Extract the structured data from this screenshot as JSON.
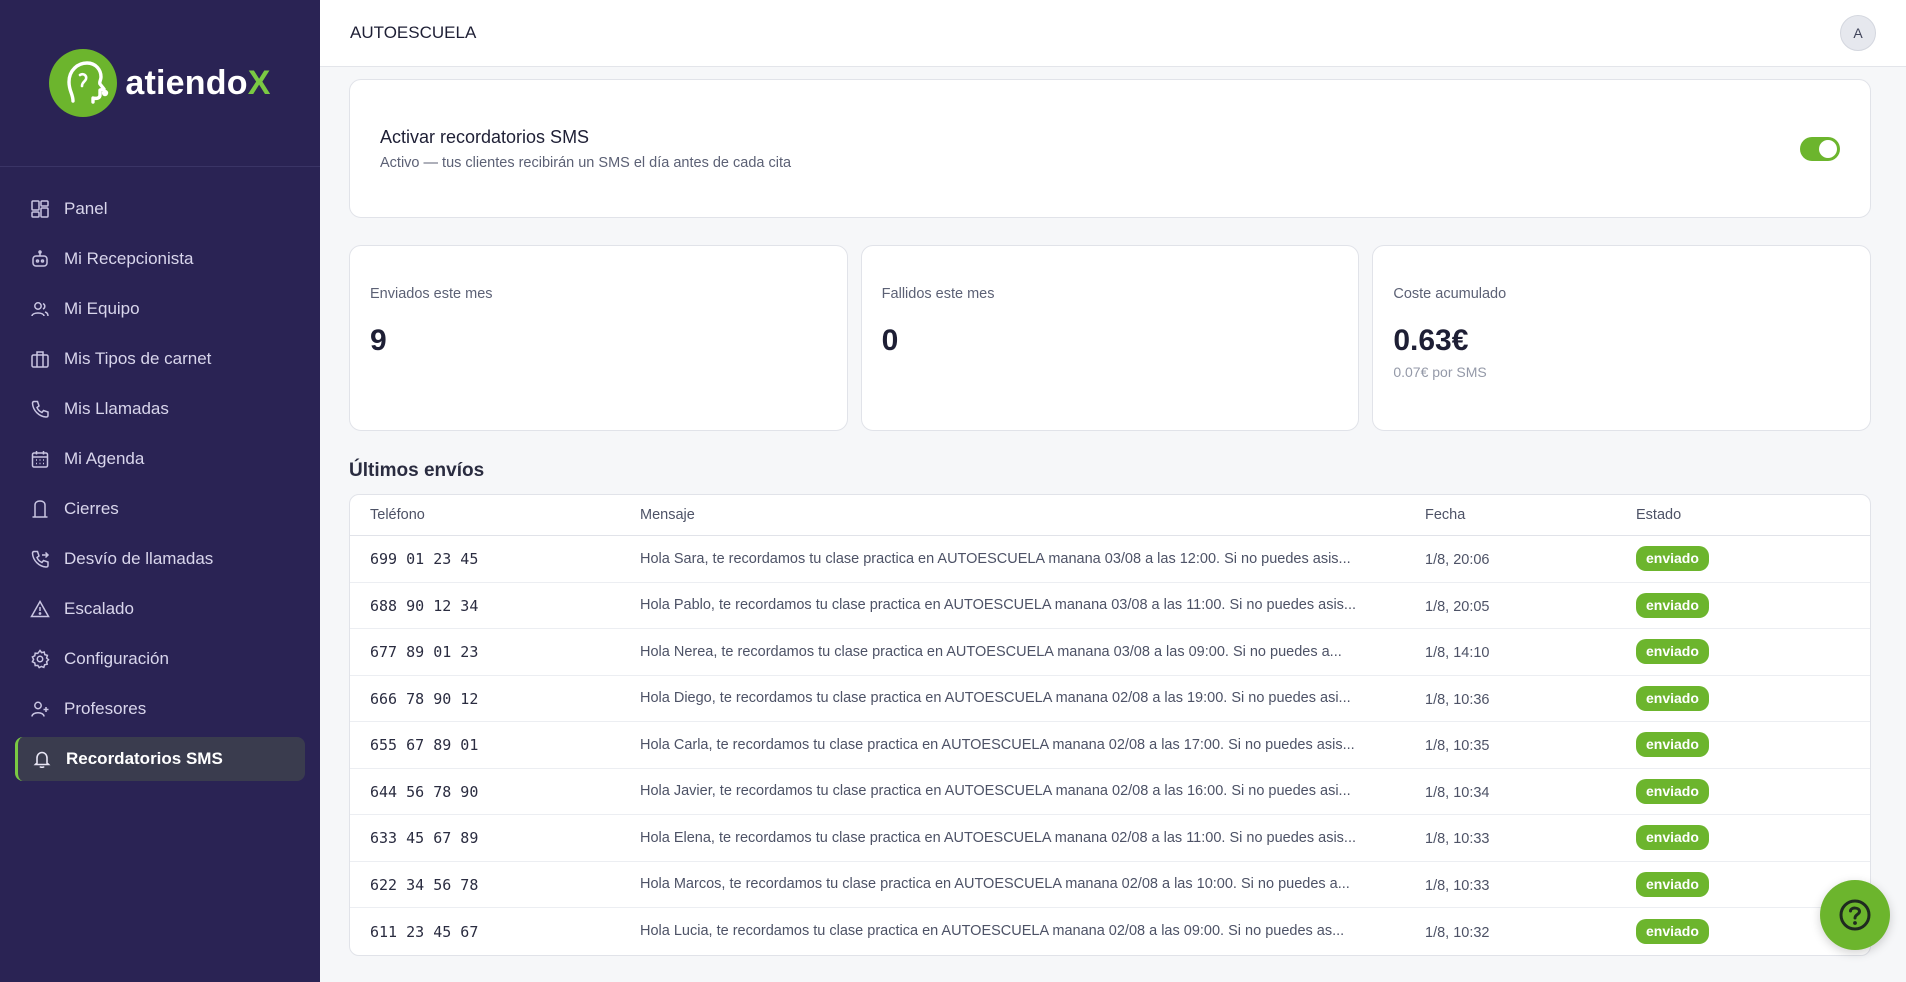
{
  "brand": {
    "logo_text": "atiendo",
    "logo_x": "X"
  },
  "header": {
    "title": "AUTOESCUELA",
    "avatar": "A"
  },
  "sidebar": {
    "items": [
      {
        "label": "Panel",
        "icon": "dashboard-icon"
      },
      {
        "label": "Mi Recepcionista",
        "icon": "bot-icon"
      },
      {
        "label": "Mi Equipo",
        "icon": "users-icon"
      },
      {
        "label": "Mis Tipos de carnet",
        "icon": "briefcase-icon"
      },
      {
        "label": "Mis Llamadas",
        "icon": "phone-icon"
      },
      {
        "label": "Mi Agenda",
        "icon": "calendar-icon"
      },
      {
        "label": "Cierres",
        "icon": "closure-icon"
      },
      {
        "label": "Desvío de llamadas",
        "icon": "phone-forward-icon"
      },
      {
        "label": "Escalado",
        "icon": "alert-triangle-icon"
      },
      {
        "label": "Configuración",
        "icon": "gear-icon"
      },
      {
        "label": "Profesores",
        "icon": "user-plus-icon"
      },
      {
        "label": "Recordatorios SMS",
        "icon": "bell-icon",
        "active": true
      }
    ]
  },
  "toggle": {
    "title": "Activar recordatorios SMS",
    "subtitle": "Activo — tus clientes recibirán un SMS el día antes de cada cita",
    "enabled": true
  },
  "stats": [
    {
      "label": "Enviados este mes",
      "value": "9",
      "sub": ""
    },
    {
      "label": "Fallidos este mes",
      "value": "0",
      "sub": ""
    },
    {
      "label": "Coste acumulado",
      "value": "0.63€",
      "sub": "0.07€ por SMS"
    }
  ],
  "table": {
    "title": "Últimos envíos",
    "headers": [
      "Teléfono",
      "Mensaje",
      "Fecha",
      "Estado"
    ],
    "rows": [
      {
        "phone": "699 01 23 45",
        "message": "Hola Sara, te recordamos tu clase practica en AUTOESCUELA manana 03/08 a las 12:00. Si no puedes asis...",
        "date": "1/8, 20:06",
        "status": "enviado"
      },
      {
        "phone": "688 90 12 34",
        "message": "Hola Pablo, te recordamos tu clase practica en AUTOESCUELA manana 03/08 a las 11:00. Si no puedes asis...",
        "date": "1/8, 20:05",
        "status": "enviado"
      },
      {
        "phone": "677 89 01 23",
        "message": "Hola Nerea, te recordamos tu clase practica en AUTOESCUELA manana 03/08 a las 09:00. Si no puedes a...",
        "date": "1/8, 14:10",
        "status": "enviado"
      },
      {
        "phone": "666 78 90 12",
        "message": "Hola Diego, te recordamos tu clase practica en AUTOESCUELA manana 02/08 a las 19:00. Si no puedes asi...",
        "date": "1/8, 10:36",
        "status": "enviado"
      },
      {
        "phone": "655 67 89 01",
        "message": "Hola Carla, te recordamos tu clase practica en AUTOESCUELA manana 02/08 a las 17:00. Si no puedes asis...",
        "date": "1/8, 10:35",
        "status": "enviado"
      },
      {
        "phone": "644 56 78 90",
        "message": "Hola Javier, te recordamos tu clase practica en AUTOESCUELA manana 02/08 a las 16:00. Si no puedes asi...",
        "date": "1/8, 10:34",
        "status": "enviado"
      },
      {
        "phone": "633 45 67 89",
        "message": "Hola Elena, te recordamos tu clase practica en AUTOESCUELA manana 02/08 a las 11:00. Si no puedes asis...",
        "date": "1/8, 10:33",
        "status": "enviado"
      },
      {
        "phone": "622 34 56 78",
        "message": "Hola Marcos, te recordamos tu clase practica en AUTOESCUELA manana 02/08 a las 10:00. Si no puedes a...",
        "date": "1/8, 10:33",
        "status": "enviado"
      },
      {
        "phone": "611 23 45 67",
        "message": "Hola Lucia, te recordamos tu clase practica en AUTOESCUELA manana 02/08 a las 09:00. Si no puedes as...",
        "date": "1/8, 10:32",
        "status": "enviado"
      }
    ]
  },
  "colors": {
    "sidebar": "#2a2354",
    "accent": "#6cb52d",
    "active_item": "#3a3c4e"
  }
}
